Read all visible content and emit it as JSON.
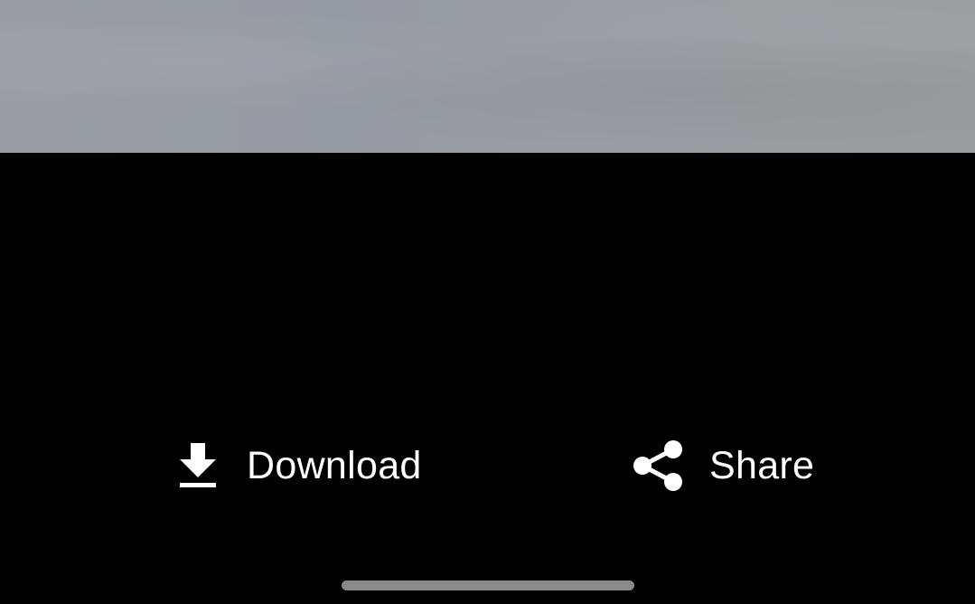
{
  "viewer": {
    "preview_colors": {
      "background": "#000000",
      "image_tint": "#9a9ea3"
    }
  },
  "actions": {
    "download": {
      "label": "Download",
      "icon": "download-icon"
    },
    "share": {
      "label": "Share",
      "icon": "share-icon"
    }
  },
  "system": {
    "home_indicator_color": "#8a8a8a"
  }
}
